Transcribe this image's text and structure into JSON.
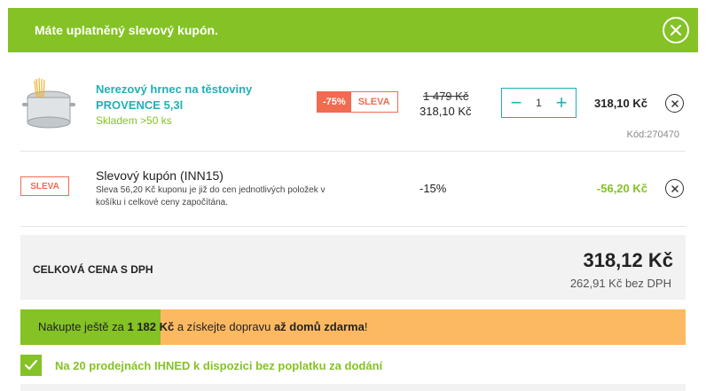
{
  "banner": {
    "text": "Máte uplatněný slevový kupón."
  },
  "item": {
    "name": "Nerezový hrnec na těstoviny PROVENCE 5,3l",
    "stock": "Skladem >50 ks",
    "discount_pct": "-75%",
    "discount_word": "SLEVA",
    "price_old": "1 479 Kč",
    "price_new": "318,10 Kč",
    "quantity": "1",
    "total": "318,10 Kč",
    "code": "Kód:270470"
  },
  "coupon": {
    "badge": "SLEVA",
    "title": "Slevový kupón (INN15)",
    "description": "Sleva 56,20 Kč kuponu je již do cen jednotlivých položek v košíku i celkové ceny započítána.",
    "percent": "-15%",
    "amount": "-56,20 Kč"
  },
  "summary": {
    "label": "CELKOVÁ CENA S DPH",
    "total": "318,12 Kč",
    "net": "262,91 Kč bez DPH"
  },
  "shipping": {
    "prefix": "Nakupte ještě za ",
    "amount": "1 182 Kč",
    "middle": " a získejte dopravu ",
    "strong": "až domů zdarma",
    "suffix": "!",
    "progress": 0.21
  },
  "store": {
    "text": "Na 20 prodejnách IHNED k dispozici bez poplatku za dodání"
  },
  "colors": {
    "accent_green": "#84c225",
    "accent_teal": "#1fb0b7",
    "sale_red": "#f06b50",
    "ship_orange": "#fdb962"
  }
}
